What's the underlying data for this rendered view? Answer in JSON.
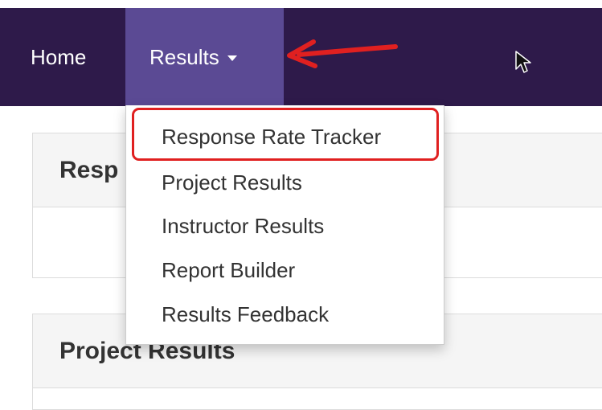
{
  "navbar": {
    "home_label": "Home",
    "results_label": "Results",
    "bg_color": "#2e1a4a",
    "active_color": "#5b4a94"
  },
  "dropdown": {
    "items": [
      {
        "label": "Response Rate Tracker",
        "highlighted": true
      },
      {
        "label": "Project Results"
      },
      {
        "label": "Instructor Results"
      },
      {
        "label": "Report Builder"
      },
      {
        "label": "Results Feedback"
      }
    ]
  },
  "panels": [
    {
      "title": "Resp"
    },
    {
      "title": "Project Results"
    }
  ],
  "annotation": {
    "arrow_color": "#e02020",
    "highlight_color": "#e02020"
  }
}
